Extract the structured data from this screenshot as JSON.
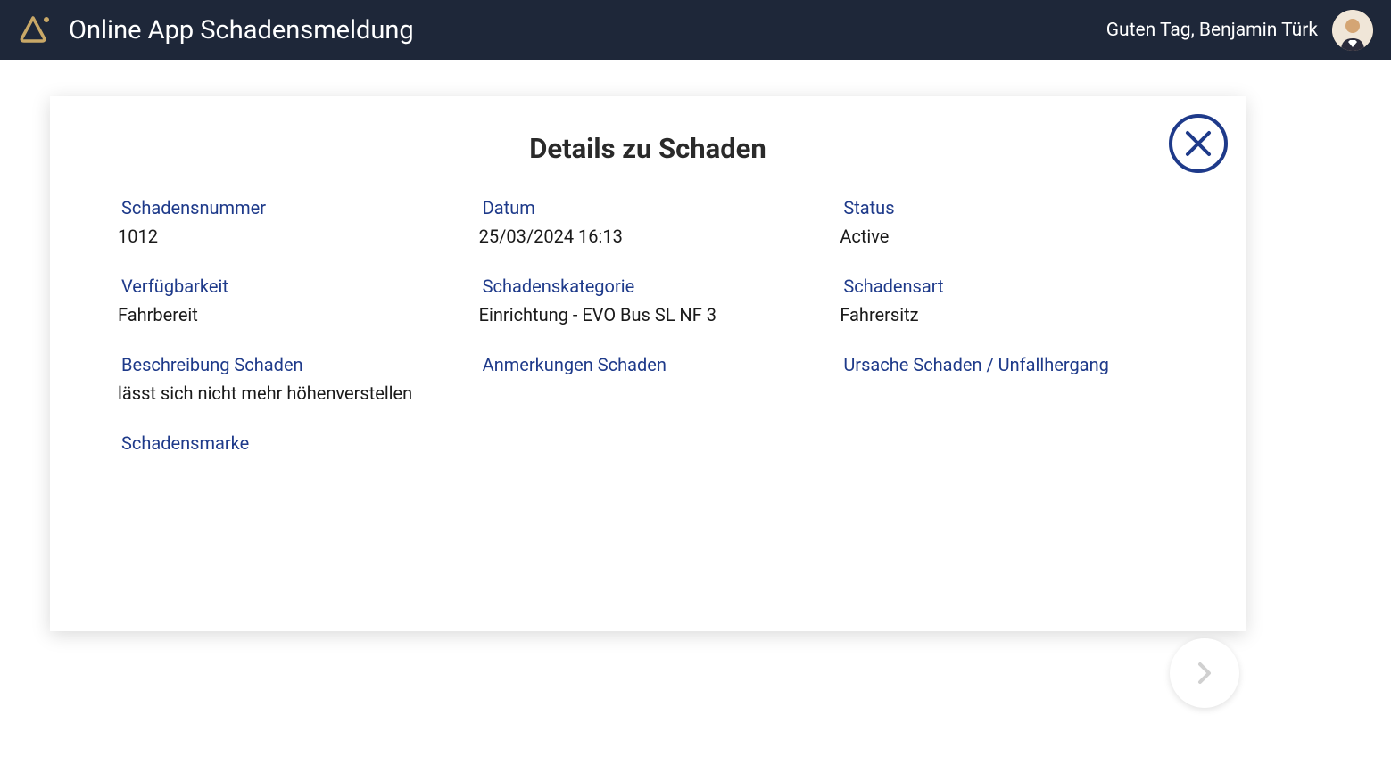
{
  "header": {
    "app_title": "Online App Schadensmeldung",
    "greeting": "Guten Tag, Benjamin Türk"
  },
  "card": {
    "title": "Details zu Schaden"
  },
  "fields": {
    "schadensnummer": {
      "label": "Schadensnummer",
      "value": "1012"
    },
    "datum": {
      "label": "Datum",
      "value": "25/03/2024 16:13"
    },
    "status": {
      "label": "Status",
      "value": "Active"
    },
    "verfuegbarkeit": {
      "label": "Verfügbarkeit",
      "value": "Fahrbereit"
    },
    "schadenskategorie": {
      "label": "Schadenskategorie",
      "value": "Einrichtung - EVO Bus SL NF 3"
    },
    "schadensart": {
      "label": "Schadensart",
      "value": "Fahrersitz"
    },
    "beschreibung": {
      "label": "Beschreibung Schaden",
      "value": "lässt sich nicht mehr höhenverstellen"
    },
    "anmerkungen": {
      "label": "Anmerkungen Schaden",
      "value": ""
    },
    "ursache": {
      "label": "Ursache Schaden / Unfallhergang",
      "value": ""
    },
    "schadensmarke": {
      "label": "Schadensmarke",
      "value": ""
    }
  },
  "colors": {
    "header_bg": "#1e2739",
    "label_color": "#1e3a8a",
    "text_color": "#1a1a1a"
  }
}
